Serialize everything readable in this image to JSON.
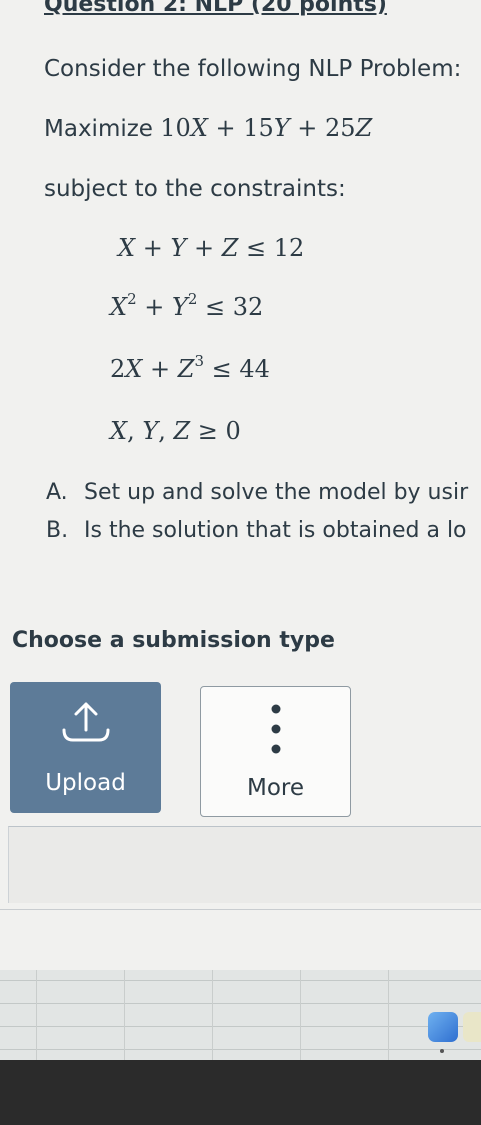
{
  "question": {
    "title": "Question 2: NLP (20 points)",
    "intro": "Consider the following NLP Problem:",
    "objective_label": "Maximize",
    "subject_to": "subject to the constraints:",
    "parts": [
      {
        "label": "A.",
        "text": "Set up and solve the model by usir"
      },
      {
        "label": "B.",
        "text": "Is the solution that is obtained a lo"
      }
    ]
  },
  "submission": {
    "heading": "Choose a submission type",
    "upload_label": "Upload",
    "more_label": "More"
  },
  "colors": {
    "upload_bg": "#5d7b98",
    "text": "#2d3b45",
    "bezel": "#2b2b2b"
  },
  "icons": [
    "upload-icon",
    "more-dots-icon",
    "dock-app-icon"
  ]
}
